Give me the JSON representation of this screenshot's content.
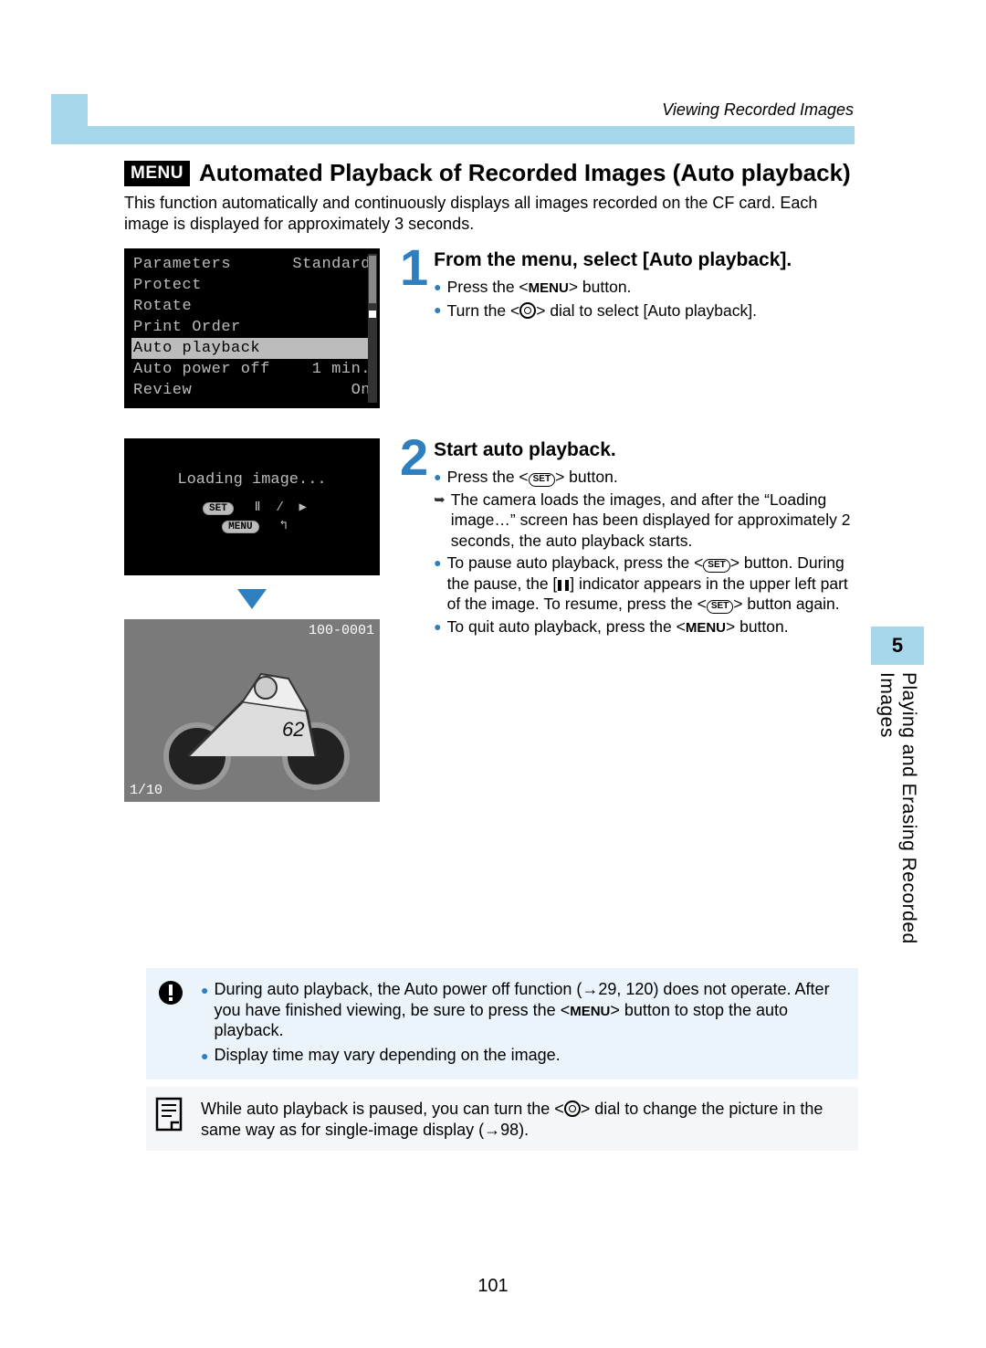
{
  "header": {
    "running_head": "Viewing Recorded Images",
    "menu_badge": "MENU",
    "title": "Automated Playback of Recorded Images (Auto playback)",
    "intro": "This function automatically and continuously displays all images recorded on the CF card. Each image is displayed for approximately 3 seconds."
  },
  "lcd_menu": {
    "items": [
      {
        "label": "Parameters",
        "value": "Standard"
      },
      {
        "label": "Protect",
        "value": ""
      },
      {
        "label": "Rotate",
        "value": ""
      },
      {
        "label": "Print Order",
        "value": ""
      },
      {
        "label": "Auto playback",
        "value": "",
        "selected": true
      },
      {
        "label": "Auto power off",
        "value": "1 min."
      },
      {
        "label": "Review",
        "value": "On"
      }
    ]
  },
  "lcd_loading": {
    "text": "Loading image...",
    "btn1": "SET",
    "btn2": "MENU"
  },
  "photo": {
    "file_number": "100-0001",
    "counter": "1/10"
  },
  "steps": [
    {
      "num": "1",
      "title": "From the menu, select [Auto playback].",
      "bullets": [
        {
          "pre": "Press the <",
          "mid_type": "menu",
          "mid": "MENU",
          "post": "> button."
        },
        {
          "pre": "Turn the <",
          "mid_type": "dial",
          "post": "> dial to select [Auto playback]."
        }
      ]
    },
    {
      "num": "2",
      "title": "Start auto playback.",
      "bullets": [
        {
          "pre": "Press the <",
          "mid_type": "set",
          "mid": "SET",
          "post": "> button."
        },
        {
          "type": "arrow",
          "text": "The camera loads the images, and after the “Loading image…” screen has been displayed for approximately 2 seconds, the auto playback starts."
        },
        {
          "pre": "To pause auto playback, press the <",
          "mid_type": "set",
          "mid": "SET",
          "post": "> button. During the pause, the [",
          "pause": true,
          "post2": "] indicator appears in the upper left part of the image. To resume, press the <",
          "mid_type2": "set",
          "mid2": "SET",
          "post3": "> button again."
        },
        {
          "pre": "To quit auto playback, press the <",
          "mid_type": "menu",
          "mid": "MENU",
          "post": "> button."
        }
      ]
    }
  ],
  "sidebar": {
    "chapter_num": "5",
    "chapter_title": "Playing and Erasing Recorded Images"
  },
  "notes": {
    "caution": [
      "During auto playback, the Auto power off function (→29, 120) does not operate. After you have finished viewing, be sure to press the <MENU> button to stop the auto playback.",
      "Display time may vary depending on the image."
    ],
    "tip": "While auto playback is paused, you can turn the <DIAL> dial to change the picture in the same way as for single-image display (→98)."
  },
  "page_number": "101"
}
